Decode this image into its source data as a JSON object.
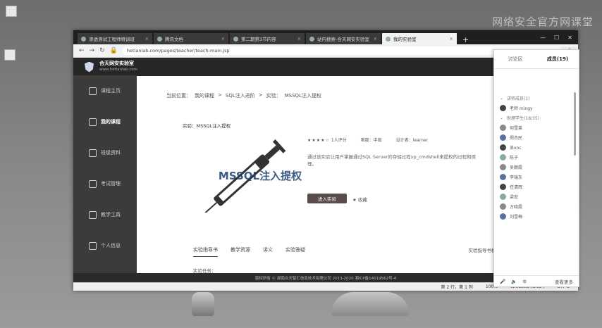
{
  "overlay": {
    "watermark": "网络安全官方网课堂"
  },
  "browser": {
    "tabs": [
      {
        "title": "渗透测试工程师特训班"
      },
      {
        "title": "腾讯文档"
      },
      {
        "title": "第二期第3节内容"
      },
      {
        "title": "站内搜索-合天网安实验室"
      },
      {
        "title": "我的实验室"
      }
    ],
    "new_tab": "+",
    "url": "hetianlab.com/pages/teacher/teach-main.jsp"
  },
  "site": {
    "logo_title": "合天网安实验室",
    "logo_subtitle": "www.hetianlab.com"
  },
  "sidebar": {
    "items": [
      {
        "label": "课程主页",
        "icon": "home-icon"
      },
      {
        "label": "我的课程",
        "icon": "book-icon"
      },
      {
        "label": "班级资料",
        "icon": "folder-icon"
      },
      {
        "label": "考试管理",
        "icon": "clipboard-icon"
      },
      {
        "label": "教学工具",
        "icon": "tools-icon"
      },
      {
        "label": "个人信息",
        "icon": "user-icon"
      }
    ]
  },
  "breadcrumb": [
    "当前位置：",
    "我的课程",
    ">",
    "SQL注入进阶",
    ">",
    "实验：",
    "MSSQL注入提权"
  ],
  "experiment": {
    "label": "实验：MSSQL注入提权",
    "banner_text": "MSSQL注入提权",
    "rating": "1人评分",
    "rating_stars": 4,
    "difficulty": "难度：中级",
    "author": "设计者：learner",
    "description": "通过该实验让用户掌握通过SQL Server的存储过程xp_cmdshell来提权的过程和原理。",
    "enter_button": "进入实验",
    "favorite": "收藏"
  },
  "content_tabs": [
    "实验指导书",
    "教学资源",
    "讲义",
    "实验答疑"
  ],
  "guide_link": "实验指导书模板",
  "task_label": "实验任务：",
  "footer": "版权所有 © 湖南合天智汇信息技术有限公司 2013-2020 湘ICP备14019562号-4",
  "statusbar": {
    "cursor": "第 2 行，第 1 列",
    "zoom": "100%",
    "line_ending": "Windows (CRLF)",
    "encoding": "UTF-8"
  },
  "panel": {
    "tab_discussion": "讨论区",
    "tab_members": "成员(19)",
    "members": [
      {
        "label": "讲师成员(1)",
        "type": "group"
      },
      {
        "label": "老师 mingy",
        "type": "user"
      },
      {
        "label": "助理学生(18/35)",
        "type": "group"
      },
      {
        "label": "何雪莱",
        "type": "user"
      },
      {
        "label": "郑杰民",
        "type": "user"
      },
      {
        "label": "吴xnc",
        "type": "user"
      },
      {
        "label": "陈子",
        "type": "user"
      },
      {
        "label": "吴朝霞",
        "type": "user"
      },
      {
        "label": "李瑞东",
        "type": "user"
      },
      {
        "label": "任清辉",
        "type": "user"
      },
      {
        "label": "梁宏",
        "type": "user"
      },
      {
        "label": "方晓霞",
        "type": "user"
      },
      {
        "label": "刘雪梅",
        "type": "user"
      }
    ],
    "footer_link": "查看更多"
  }
}
